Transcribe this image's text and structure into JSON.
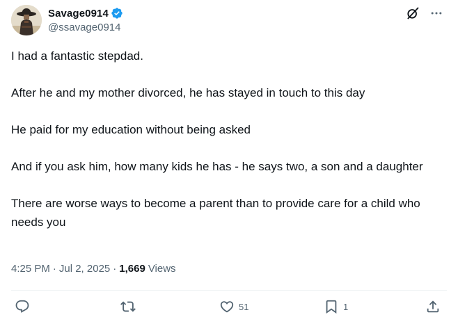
{
  "user": {
    "display_name": "Savage0914",
    "handle": "@ssavage0914",
    "verified": true
  },
  "icons": {
    "verified": "verified-badge-icon",
    "grok": "grok-icon",
    "more": "more-icon",
    "reply": "reply-icon",
    "repost": "repost-icon",
    "like": "like-icon",
    "bookmark": "bookmark-icon",
    "share": "share-icon"
  },
  "colors": {
    "verified_blue": "#1d9bf0",
    "secondary_text": "#536471",
    "primary_text": "#0f1419"
  },
  "tweet": {
    "paragraphs": [
      "I had a fantastic stepdad.",
      "After he and my mother divorced, he has stayed in touch to this day",
      "He paid for my education without being asked",
      "And if you ask him, how many kids he has - he says two, a son and a daughter",
      "There are worse ways to become a parent than to provide care for a child who needs you"
    ],
    "time": "4:25 PM",
    "date": "Jul 2, 2025",
    "separator": "·",
    "views_count": "1,669",
    "views_label": "Views"
  },
  "actions": {
    "reply_count": "",
    "repost_count": "",
    "like_count": "51",
    "bookmark_count": "1"
  }
}
